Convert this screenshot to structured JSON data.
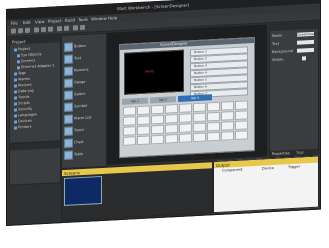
{
  "window": {
    "title": "Start Workbench - [ScreenDesigner]"
  },
  "menubar": {
    "items": [
      "File",
      "Edit",
      "View",
      "Project",
      "Build",
      "Tools",
      "Window",
      "Help"
    ]
  },
  "project_tree": {
    "title": "Project",
    "items": [
      "Project",
      "Sys Objects",
      "Screen1",
      "Ethernet Adapter 1",
      "Tags",
      "Alarms",
      "Recipes",
      "Data Log",
      "Trends",
      "Scripts",
      "Security",
      "Languages",
      "Devices",
      "Printers"
    ]
  },
  "palette": {
    "items": [
      "Button",
      "Text",
      "Numeric",
      "Gauge",
      "Switch",
      "Symbol",
      "Alarm List",
      "Trend",
      "Chart",
      "Table"
    ]
  },
  "screen_designer": {
    "title": "ScreenDesigner",
    "screen_text": "Hello",
    "buttons": [
      "Button 1",
      "Button 2",
      "Button 3",
      "Button 4",
      "Button 5",
      "Button 6",
      "Button 7"
    ],
    "tabs": [
      "Tab 1",
      "Tab 2",
      "Tab 3"
    ],
    "active_tab_index": 2
  },
  "properties": {
    "title": "Properties",
    "rows": [
      {
        "label": "Name",
        "value": "ScreenDesigner"
      },
      {
        "label": "Text",
        "value": ""
      },
      {
        "label": "Background",
        "value": ""
      },
      {
        "label": "Visible",
        "value": ""
      }
    ],
    "footer_tabs": [
      "Properties",
      "Tags"
    ]
  },
  "screens_panel": {
    "title": "Screens"
  },
  "log_panel": {
    "title": "Output",
    "columns": [
      "Component",
      "Device",
      "Trigger"
    ]
  },
  "colors": {
    "window_bg": "#2e3032",
    "accent": "#2f6fb6",
    "screen_bg": "#000000"
  }
}
